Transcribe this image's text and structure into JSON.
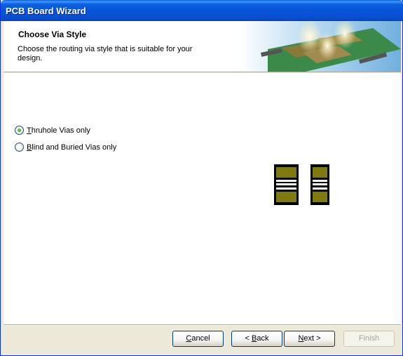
{
  "window": {
    "title": "PCB Board Wizard"
  },
  "header": {
    "title": "Choose Via Style",
    "description": "Choose  the routing via style that is suitable for your design."
  },
  "options": [
    {
      "accel": "T",
      "rest": "hruhole Vias only",
      "selected": true
    },
    {
      "accel": "B",
      "rest": "lind and Buried Vias only",
      "selected": false
    }
  ],
  "buttons": {
    "cancel": {
      "accel": "C",
      "rest": "ancel"
    },
    "back": {
      "prefix": "< ",
      "accel": "B",
      "rest": "ack"
    },
    "next": {
      "accel": "N",
      "rest": "ext >"
    },
    "finish": {
      "label": "Finish"
    }
  },
  "colors": {
    "via_pad": "#7f7a10",
    "via_border": "#000000"
  }
}
